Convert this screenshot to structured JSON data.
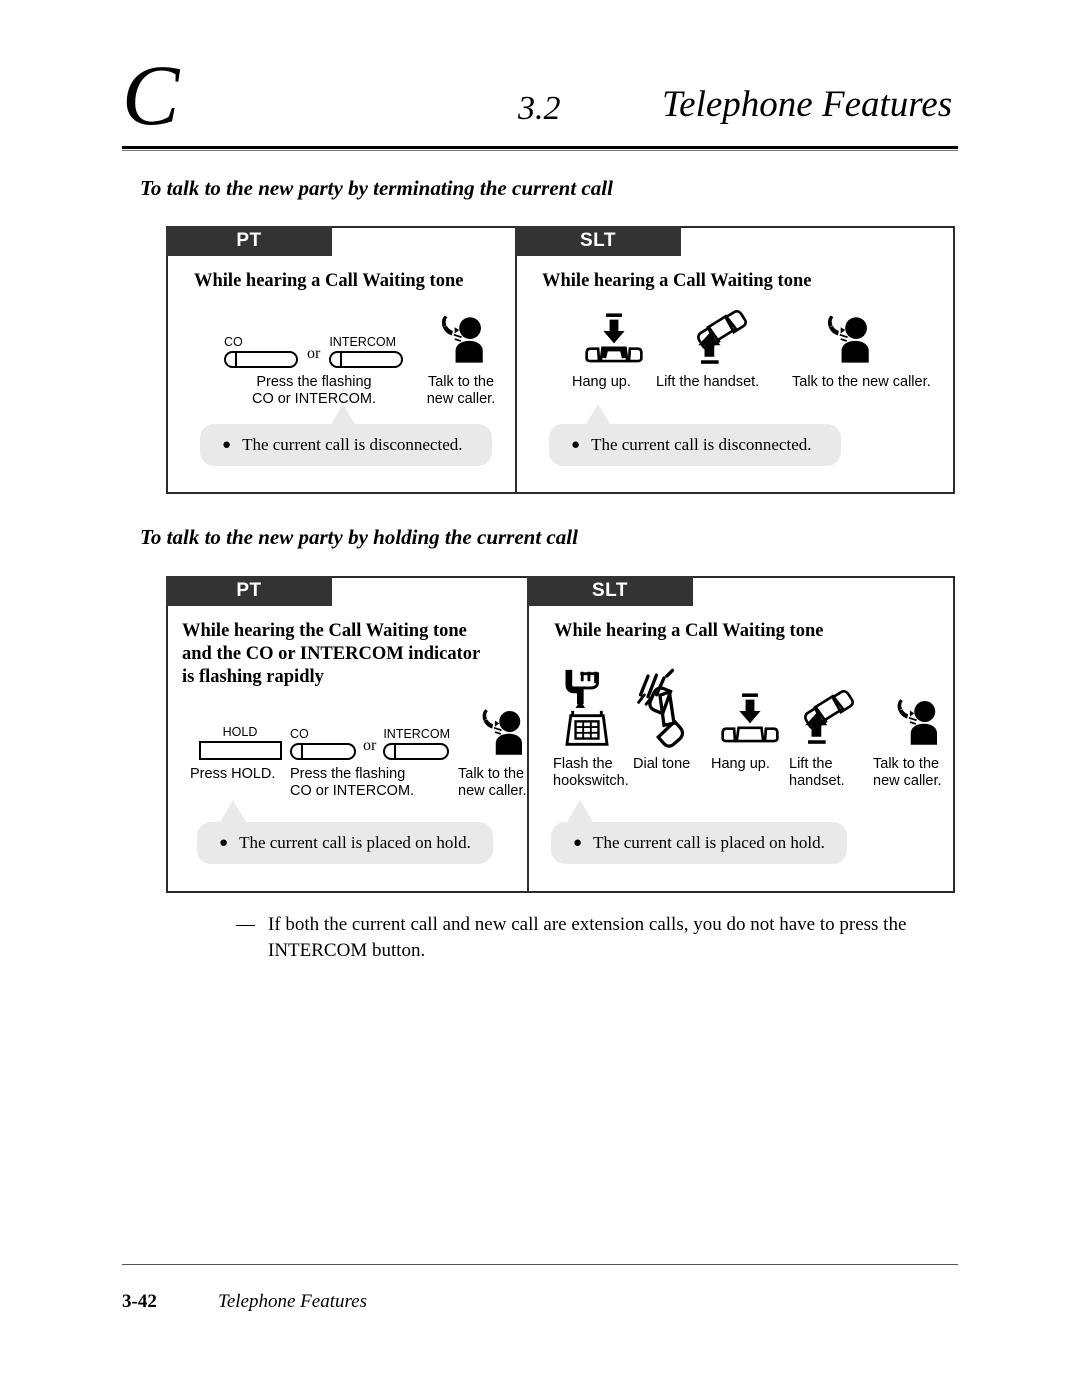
{
  "header": {
    "chapter_letter": "C",
    "section_number": "3.2",
    "section_title": "Telephone Features",
    "rule_color": "#000000"
  },
  "sections": [
    {
      "heading": "To talk to the new party by terminating the current call",
      "panels": [
        {
          "tab": "PT",
          "heading": "While hearing a Call Waiting tone",
          "steps": [
            {
              "kind": "pt-buttons",
              "buttons": [
                {
                  "name": "CO",
                  "lamp": true,
                  "shape": "rounded"
                },
                {
                  "name": "INTERCOM",
                  "lamp": true,
                  "shape": "rounded"
                }
              ],
              "separator": "or",
              "label": "Press the flashing\nCO or INTERCOM."
            },
            {
              "kind": "icon",
              "icon": "talk-to-caller-icon",
              "label": "Talk to the\nnew caller."
            }
          ],
          "callout": "The current call is disconnected."
        },
        {
          "tab": "SLT",
          "heading": "While hearing a Call Waiting tone",
          "steps": [
            {
              "kind": "icon",
              "icon": "hang-up-icon",
              "label": "Hang up."
            },
            {
              "kind": "icon",
              "icon": "lift-handset-icon",
              "label": "Lift the handset."
            },
            {
              "kind": "icon",
              "icon": "talk-to-caller-icon",
              "label": "Talk to the new caller."
            }
          ],
          "callout": "The current call is disconnected."
        }
      ]
    },
    {
      "heading": "To talk to the new party by holding the current call",
      "panels": [
        {
          "tab": "PT",
          "heading": "While hearing the Call Waiting tone\nand the CO or INTERCOM indicator\nis flashing rapidly",
          "steps": [
            {
              "kind": "pt-buttons",
              "buttons": [
                {
                  "name": "HOLD",
                  "lamp": false,
                  "shape": "square"
                }
              ],
              "label": "Press HOLD."
            },
            {
              "kind": "pt-buttons",
              "buttons": [
                {
                  "name": "CO",
                  "lamp": true,
                  "shape": "rounded"
                },
                {
                  "name": "INTERCOM",
                  "lamp": true,
                  "shape": "rounded"
                }
              ],
              "separator": "or",
              "label": "Press the flashing\nCO or INTERCOM."
            },
            {
              "kind": "icon",
              "icon": "talk-to-caller-icon",
              "label": "Talk to the\nnew caller."
            }
          ],
          "callout": "The current call is placed on hold."
        },
        {
          "tab": "SLT",
          "heading": "While hearing a Call Waiting tone",
          "steps": [
            {
              "kind": "icon",
              "icon": "flash-hookswitch-icon",
              "label": "Flash the\nhookswitch."
            },
            {
              "kind": "icon",
              "icon": "dial-tone-icon",
              "label": "Dial tone"
            },
            {
              "kind": "icon",
              "icon": "hang-up-icon",
              "label": "Hang up."
            },
            {
              "kind": "icon",
              "icon": "lift-handset-icon",
              "label": "Lift the\nhandset."
            },
            {
              "kind": "icon",
              "icon": "talk-to-caller-icon",
              "label": "Talk to the\nnew caller."
            }
          ],
          "callout": "The current call is placed on hold."
        }
      ]
    }
  ],
  "note": {
    "dash": "—",
    "text": "If both the current call and new call are extension calls, you do not have to press the INTERCOM button."
  },
  "footer": {
    "page_number": "3-42",
    "title": "Telephone Features"
  },
  "colors": {
    "tab_background": "#333333",
    "callout_background": "#e9e9e9",
    "border": "#2b2b2b"
  }
}
